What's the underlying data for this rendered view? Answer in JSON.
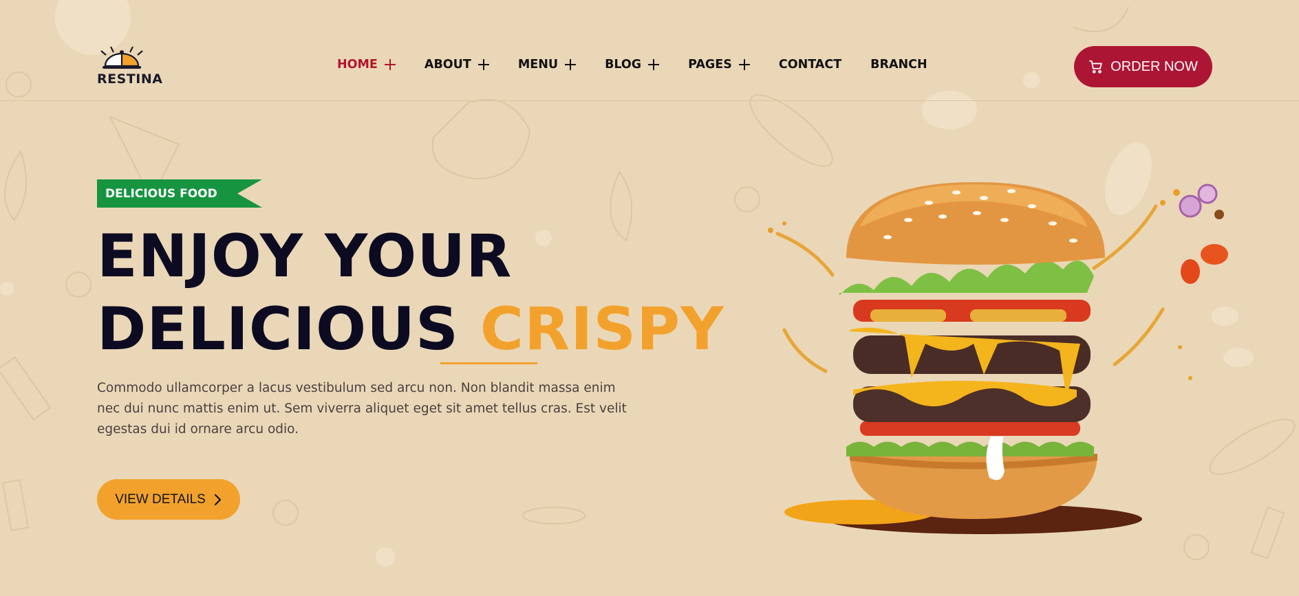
{
  "brand": {
    "name": "RESTINA"
  },
  "nav": [
    {
      "label": "HOME",
      "has_submenu": true,
      "active": true
    },
    {
      "label": "ABOUT",
      "has_submenu": true
    },
    {
      "label": "MENU",
      "has_submenu": true
    },
    {
      "label": "BLOG",
      "has_submenu": true
    },
    {
      "label": "PAGES",
      "has_submenu": true
    },
    {
      "label": "CONTACT",
      "has_submenu": false
    },
    {
      "label": "BRANCH",
      "has_submenu": false
    }
  ],
  "header": {
    "order_label": "ORDER NOW",
    "order_icon": "cart-icon"
  },
  "hero": {
    "badge": "DELICIOUS FOOD",
    "title_line1": "ENJOY YOUR",
    "title_line2_dark": "DELICIOUS",
    "title_line2_accent": "CRISPY",
    "description": "Commodo ullamcorper a lacus vestibulum sed arcu non. Non blandit massa enim nec dui nunc mattis enim ut. Sem viverra aliquet eget sit amet tellus cras. Est velit egestas dui id ornare arcu odio.",
    "cta_label": "VIEW DETAILS",
    "image": "burger-image"
  },
  "colors": {
    "background": "#ead7b7",
    "primary_red": "#ad1535",
    "accent_orange": "#f2a22c",
    "badge_green": "#169440",
    "text_dark": "#0d0b22"
  }
}
